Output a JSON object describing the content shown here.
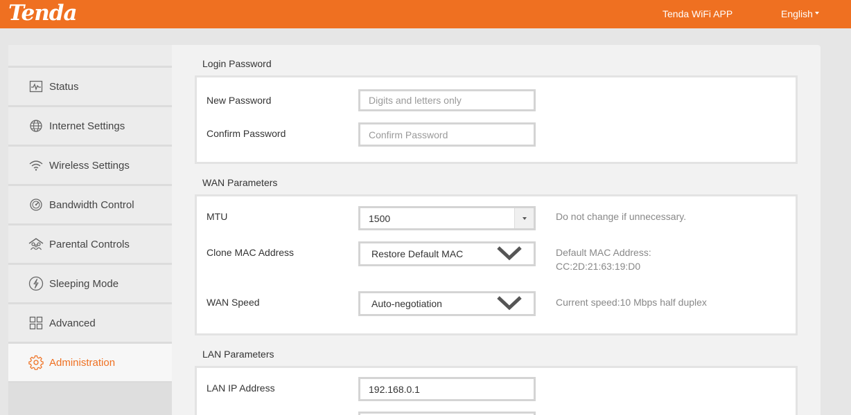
{
  "header": {
    "logo": "Tenda",
    "app_link": "Tenda WiFi APP",
    "language": "English"
  },
  "sidebar": {
    "items": [
      {
        "label": "Status",
        "icon": "status-icon"
      },
      {
        "label": "Internet Settings",
        "icon": "globe-icon"
      },
      {
        "label": "Wireless Settings",
        "icon": "wifi-icon"
      },
      {
        "label": "Bandwidth Control",
        "icon": "gauge-icon"
      },
      {
        "label": "Parental Controls",
        "icon": "family-icon"
      },
      {
        "label": "Sleeping Mode",
        "icon": "sleep-icon"
      },
      {
        "label": "Advanced",
        "icon": "grid-icon"
      },
      {
        "label": "Administration",
        "icon": "gear-icon",
        "active": true
      }
    ]
  },
  "login_password": {
    "title": "Login Password",
    "new_password_label": "New Password",
    "new_password_placeholder": "Digits and letters only",
    "confirm_password_label": "Confirm Password",
    "confirm_password_placeholder": "Confirm Password"
  },
  "wan": {
    "title": "WAN Parameters",
    "mtu_label": "MTU",
    "mtu_value": "1500",
    "mtu_hint": "Do not change if unnecessary.",
    "clone_mac_label": "Clone MAC Address",
    "clone_mac_value": "Restore Default MAC",
    "default_mac_label": "Default MAC Address:",
    "default_mac_value": "CC:2D:21:63:19:D0",
    "speed_label": "WAN Speed",
    "speed_value": "Auto-negotiation",
    "speed_hint": "Current speed:10 Mbps half duplex"
  },
  "lan": {
    "title": "LAN Parameters",
    "ip_label": "LAN IP Address",
    "ip_value": "192.168.0.1"
  },
  "colors": {
    "accent": "#ef7021",
    "background": "#e6e6e6"
  }
}
